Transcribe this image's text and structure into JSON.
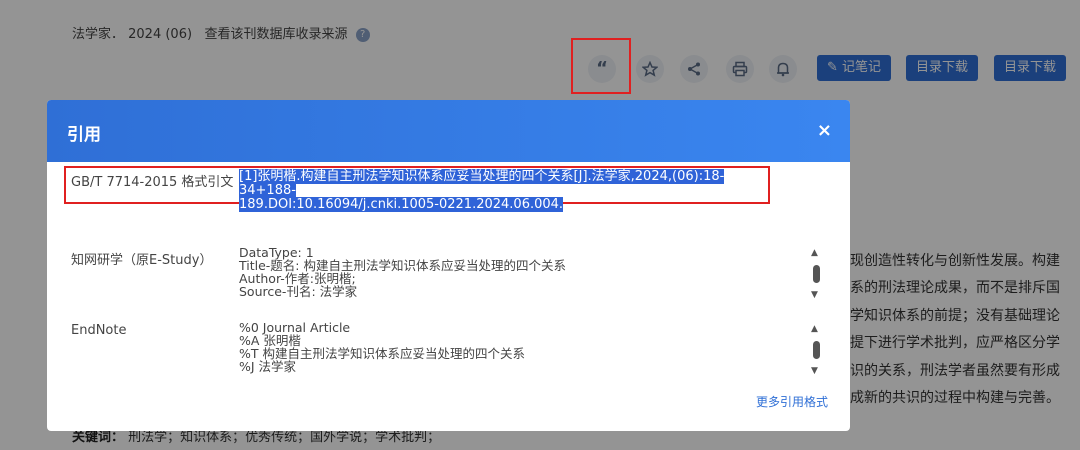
{
  "source": {
    "journal_line": "法学家． 2024 (06)",
    "db_link": "查看该刊数据库收录来源",
    "help_icon": "?"
  },
  "toolbar": {
    "cite_icon": "“",
    "note_label": "记笔记",
    "download1_label": "目录下载",
    "download2_label": "目录下载"
  },
  "background_text": {
    "line1": "现创造性转化与创新性发展。构建",
    "line2": "系的刑法理论成果，而不是排斥国",
    "line3": "学知识体系的前提；没有基础理论",
    "line4": "提下进行学术批判，应严格区分学",
    "line5": "识的关系，刑法学者虽然要有形成",
    "line6": "成新的共识的过程中构建与完善。",
    "keywords_label": "关键词：",
    "keywords": "刑法学；知识体系；优秀传统；国外学说；学术批判；"
  },
  "dialog": {
    "title": "引用",
    "close": "×",
    "gb_label": "GB/T 7714-2015 格式引文",
    "gb_line1": "[1]张明楷.构建自主刑法学知识体系应妥当处理的四个关系[J].法学家,2024,(06):18-34+188-",
    "gb_line2": "189.DOI:10.16094/j.cnki.1005-0221.2024.06.004.",
    "estudy_label": "知网研学（原E-Study）",
    "estudy_lines": [
      "DataType: 1",
      "Title-题名: 构建自主刑法学知识体系应妥当处理的四个关系",
      "Author-作者:张明楷;",
      "Source-刊名: 法学家"
    ],
    "endnote_label": "EndNote",
    "endnote_lines": [
      "%0 Journal Article",
      "%A 张明楷",
      "%T 构建自主刑法学知识体系应妥当处理的四个关系",
      "%J 法学家"
    ],
    "more_formats": "更多引用格式"
  }
}
